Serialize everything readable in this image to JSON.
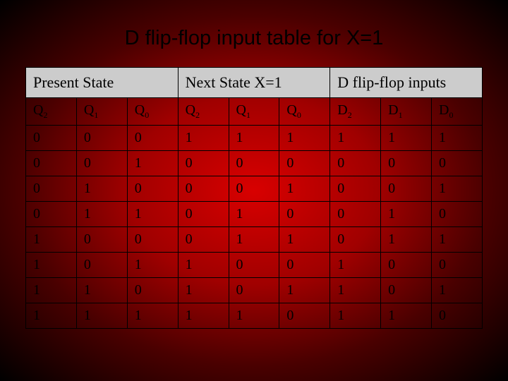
{
  "title": "D flip-flop input table for X=1",
  "headers": {
    "group0": "Present State",
    "group1": "Next State X=1",
    "group2": "D flip-flop inputs"
  },
  "subheaders": [
    {
      "base": "Q",
      "sub": "2"
    },
    {
      "base": "Q",
      "sub": "1"
    },
    {
      "base": "Q",
      "sub": "0"
    },
    {
      "base": "Q",
      "sub": "2"
    },
    {
      "base": "Q",
      "sub": "1"
    },
    {
      "base": "Q",
      "sub": "0"
    },
    {
      "base": "D",
      "sub": "2"
    },
    {
      "base": "D",
      "sub": "1"
    },
    {
      "base": "D",
      "sub": "0"
    }
  ],
  "rows": [
    [
      "0",
      "0",
      "0",
      "1",
      "1",
      "1",
      "1",
      "1",
      "1"
    ],
    [
      "0",
      "0",
      "1",
      "0",
      "0",
      "0",
      "0",
      "0",
      "0"
    ],
    [
      "0",
      "1",
      "0",
      "0",
      "0",
      "1",
      "0",
      "0",
      "1"
    ],
    [
      "0",
      "1",
      "1",
      "0",
      "1",
      "0",
      "0",
      "1",
      "0"
    ],
    [
      "1",
      "0",
      "0",
      "0",
      "1",
      "1",
      "0",
      "1",
      "1"
    ],
    [
      "1",
      "0",
      "1",
      "1",
      "0",
      "0",
      "1",
      "0",
      "0"
    ],
    [
      "1",
      "1",
      "0",
      "1",
      "0",
      "1",
      "1",
      "0",
      "1"
    ],
    [
      "1",
      "1",
      "1",
      "1",
      "1",
      "0",
      "1",
      "1",
      "0"
    ]
  ],
  "chart_data": {
    "type": "table",
    "title": "D flip-flop input table for X=1",
    "column_groups": [
      "Present State",
      "Next State X=1",
      "D flip-flop inputs"
    ],
    "columns": [
      "Q2",
      "Q1",
      "Q0",
      "Q2",
      "Q1",
      "Q0",
      "D2",
      "D1",
      "D0"
    ],
    "rows": [
      [
        0,
        0,
        0,
        1,
        1,
        1,
        1,
        1,
        1
      ],
      [
        0,
        0,
        1,
        0,
        0,
        0,
        0,
        0,
        0
      ],
      [
        0,
        1,
        0,
        0,
        0,
        1,
        0,
        0,
        1
      ],
      [
        0,
        1,
        1,
        0,
        1,
        0,
        0,
        1,
        0
      ],
      [
        1,
        0,
        0,
        0,
        1,
        1,
        0,
        1,
        1
      ],
      [
        1,
        0,
        1,
        1,
        0,
        0,
        1,
        0,
        0
      ],
      [
        1,
        1,
        0,
        1,
        0,
        1,
        1,
        0,
        1
      ],
      [
        1,
        1,
        1,
        1,
        1,
        0,
        1,
        1,
        0
      ]
    ]
  }
}
